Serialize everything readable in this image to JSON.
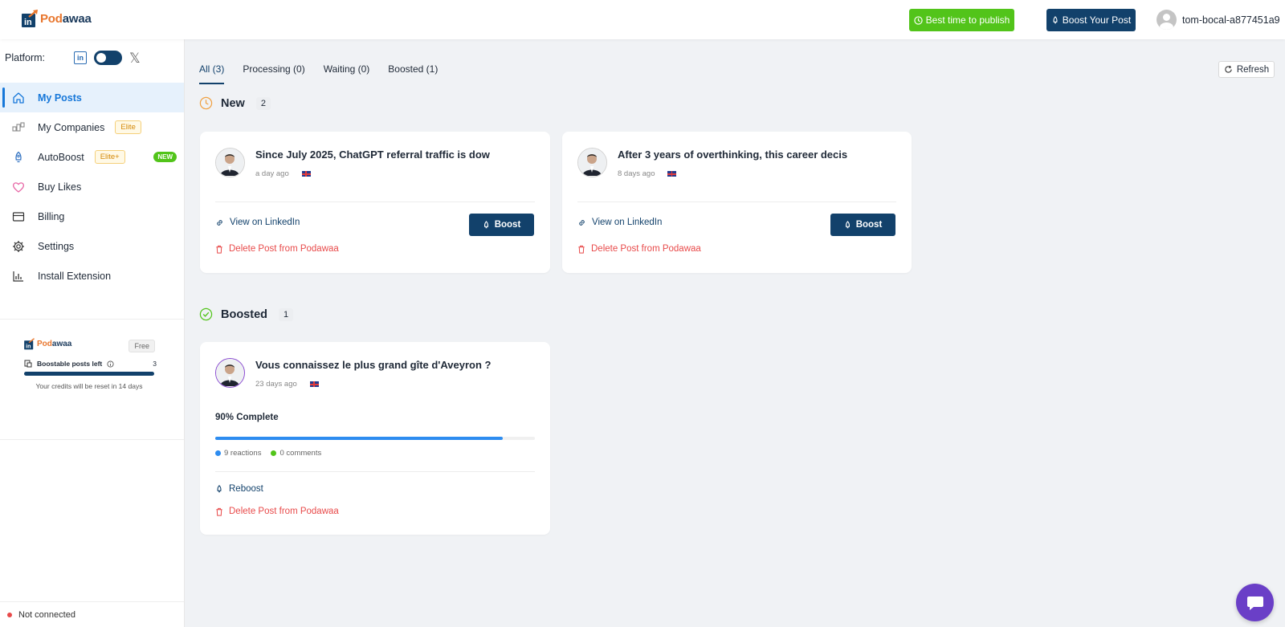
{
  "header": {
    "logo_pod": "Pod",
    "logo_awaa": "awaa",
    "best_time_label": "Best time to publish",
    "boost_post_label": "Boost Your Post",
    "username": "tom-bocal-a877451a9"
  },
  "sidebar": {
    "platform_label": "Platform:",
    "linkedin_letters": "in",
    "x_letter": "𝕏",
    "items": [
      {
        "label": "My Posts",
        "icon": "home-icon"
      },
      {
        "label": "My Companies",
        "icon": "companies-icon",
        "tag": "Elite"
      },
      {
        "label": "AutoBoost",
        "icon": "rocket-icon",
        "tag": "Elite+",
        "badge": "NEW"
      },
      {
        "label": "Buy Likes",
        "icon": "heart-icon"
      },
      {
        "label": "Billing",
        "icon": "wallet-icon"
      },
      {
        "label": "Settings",
        "icon": "gear-icon"
      },
      {
        "label": "Install Extension",
        "icon": "chart-icon"
      }
    ],
    "credits": {
      "logo_pod": "Pod",
      "logo_awaa": "awaa",
      "plan": "Free",
      "label": "Boostable posts left",
      "count": "3",
      "note": "Your credits will be reset in 14 days"
    },
    "status": "Not connected"
  },
  "tabs": [
    {
      "label": "All (3)"
    },
    {
      "label": "Processing (0)"
    },
    {
      "label": "Waiting (0)"
    },
    {
      "label": "Boosted (1)"
    }
  ],
  "refresh_label": "Refresh",
  "sections": {
    "new": {
      "title": "New",
      "count": "2",
      "posts": [
        {
          "title": "Since July 2025, ChatGPT referral traffic is dow",
          "time": "a day ago",
          "view_label": "View on LinkedIn",
          "delete_label": "Delete Post from Podawaa",
          "boost_label": "Boost"
        },
        {
          "title": "After 3 years of overthinking, this career decis",
          "time": "8 days ago",
          "view_label": "View on LinkedIn",
          "delete_label": "Delete Post from Podawaa",
          "boost_label": "Boost"
        }
      ]
    },
    "boosted": {
      "title": "Boosted",
      "count": "1",
      "post": {
        "title": "Vous connaissez le plus grand gîte d'Aveyron ?",
        "time": "23 days ago",
        "progress_label": "90% Complete",
        "progress": 0.9,
        "reactions": "9 reactions",
        "comments": "0 comments",
        "reboost_label": "Reboost",
        "delete_label": "Delete Post from Podawaa"
      }
    }
  },
  "colors": {
    "primary": "#12416b",
    "green": "#52c41a",
    "danger": "#e84a4a",
    "accent_blue": "#1677d9",
    "progress": "#2d8cf0",
    "chat": "#6a3fc7"
  }
}
